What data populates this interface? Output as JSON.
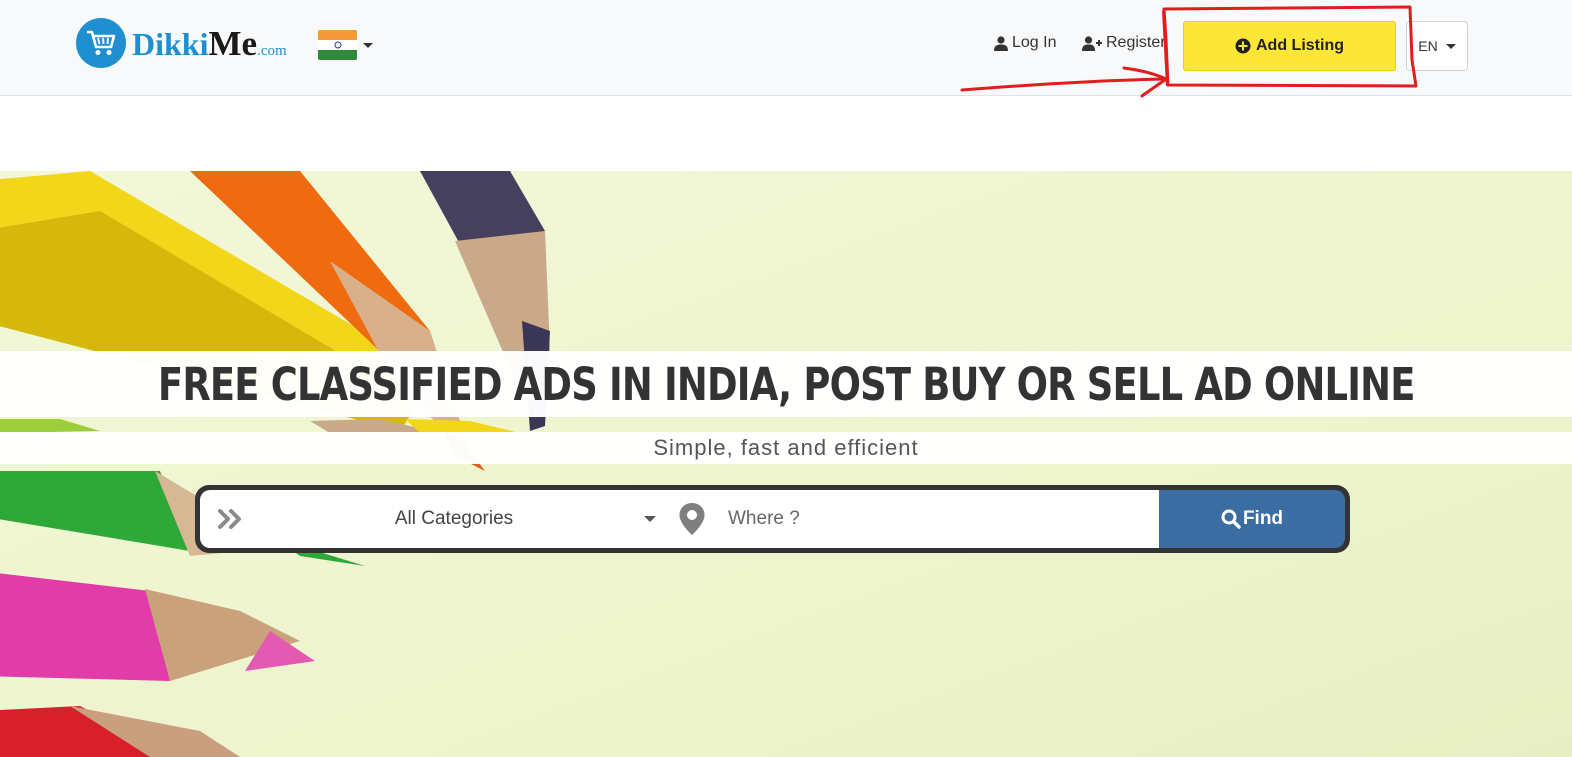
{
  "header": {
    "logo": {
      "part1": "Dikki",
      "part2": "Me",
      "part3": ".com"
    },
    "country_flag": "india-flag-icon",
    "login_label": "Log In",
    "register_label": "Register",
    "add_listing_label": "Add Listing",
    "language_label": "EN"
  },
  "hero": {
    "title": "FREE CLASSIFIED ADS IN INDIA, POST BUY OR SELL AD ONLINE",
    "subtitle": "Simple, fast and efficient"
  },
  "search": {
    "category_value": "All Categories",
    "where_placeholder": "Where ?",
    "find_label": "Find"
  },
  "colors": {
    "brand_blue": "#1f8fd1",
    "add_listing_yellow": "#fde736",
    "find_blue": "#3b6da3",
    "annotation_red": "#e01e1e"
  }
}
